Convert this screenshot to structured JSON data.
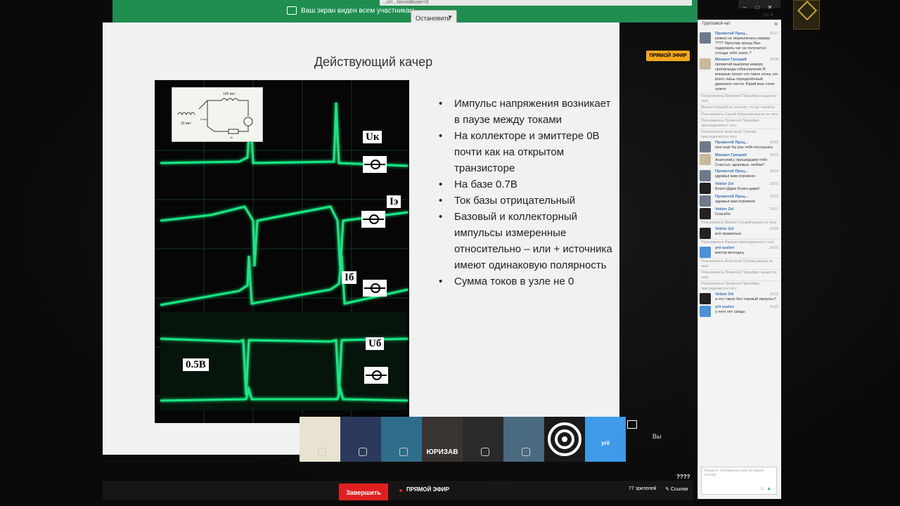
{
  "topbar": {
    "share_notice": "Ваш экран виден всем участникам",
    "stop_label": "Остановить",
    "url_fragment": "...ci=...forcedifuser=0"
  },
  "slide": {
    "title": "Действующий качер",
    "bullets": [
      "Импульс напряжения возникает в паузе между токами",
      "На коллекторе и эмиттере 0В почти  как на открытом транзисторе",
      "На базе 0.7В",
      "Ток базы отрицательный",
      "Базовый и коллекторный импульсы измеренные относительно – или + источника имеют одинаковую полярность",
      "Сумма токов в узле не 0"
    ],
    "scope_labels": {
      "uk": "Uк",
      "ie": "Iэ",
      "ib": "Iб",
      "ub": "Uб",
      "scale": "0.5В"
    },
    "circuit": {
      "l1": "30 вит",
      "l2": "100 вит",
      "l3": "5 вит",
      "r": "1k"
    }
  },
  "live_badge": "ПРЯМОЙ ЭФИР",
  "participants": [
    {
      "id": "p1",
      "name": "",
      "color": "#e8e3d0"
    },
    {
      "id": "p2",
      "name": "",
      "color": "#2b3a5a"
    },
    {
      "id": "p3",
      "name": "",
      "color": "#2f6d8a"
    },
    {
      "id": "p4",
      "name": "ЮРИЗАВ",
      "color": "#3a3430"
    },
    {
      "id": "p5",
      "name": "",
      "color": "#2a2a2a"
    },
    {
      "id": "p6",
      "name": "",
      "color": "#4a6a80"
    },
    {
      "id": "p7",
      "name": "",
      "color": "#1a1a1a"
    },
    {
      "id": "p8",
      "name": "yrii",
      "color": "#3d9be9"
    }
  ],
  "you_label": "Вы",
  "bottombar": {
    "finish_label": "Завершить",
    "live_label": "ПРЯМОЙ ЭФИР",
    "viewers": "77 зрителей",
    "links": "Ссылки",
    "qmarks": "????"
  },
  "chat": {
    "header": "Групповой чат",
    "input_placeholder": "Введите сообщение или вставьте ссылку",
    "messages": [
      {
        "type": "msg",
        "author": "Прометей Прец...",
        "time": "18:1?",
        "text": "можно не переключать камеру ???? Ярослав прошу Вас подержать чат не получится отсюда тебе знать ?",
        "avatar": "#6d7a8a"
      },
      {
        "type": "msg",
        "author": "Михаил Грецкий",
        "time": "18:38",
        "text": "прометей выключи камеру пропаганда глбансерения Я впервые понял что такое огонь это всего лишь определённый диапазон частот Юрий мне стоит нужно",
        "avatar": "#c8b89a"
      },
      {
        "type": "sys",
        "text": "Пользователь Прометей Прецейвис вышел из чата"
      },
      {
        "type": "sys",
        "text": "Михаил Грецкий не успешит, что вы говорите"
      },
      {
        "type": "sys",
        "text": "Пользователь Сергей Шершнев вышел из чата"
      },
      {
        "type": "sys",
        "text": "Пользователь Прометей Прецейвис присоединился к чату"
      },
      {
        "type": "sys",
        "text": "Пользователь Анастасия Гулиева присоединился к чату"
      },
      {
        "type": "msg",
        "author": "Прометей Прец...",
        "time": "18:53",
        "text": "мэн ещё бы раз тебя послушать",
        "avatar": "#6d7a8a"
      },
      {
        "type": "msg",
        "author": "Михаил Грецкий",
        "time": "18:53",
        "text": "Анатолий,с прошедшим тебя Счастья, здоровья, любви!!",
        "avatar": "#c8b89a"
      },
      {
        "type": "msg",
        "author": "Прометей Прец...",
        "time": "18:54",
        "text": "здравья вам огромное",
        "avatar": "#6d7a8a"
      },
      {
        "type": "msg",
        "author": "Vektor Zel",
        "time": "18:55",
        "text": "Благо-Дарю Благо-дарю!",
        "avatar": "#222"
      },
      {
        "type": "msg",
        "author": "Прометей Прец...",
        "time": "18:03",
        "text": "здравья вам огромное",
        "avatar": "#6d7a8a"
      },
      {
        "type": "msg",
        "author": "Vektor Zel",
        "time": "19:07",
        "text": "Спасибо",
        "avatar": "#222"
      },
      {
        "type": "sys",
        "text": "Пользователь Михаил Грецкий вышел из чата"
      },
      {
        "type": "msg",
        "author": "Vektor Zel",
        "time": "19:09",
        "text": "всё правильно",
        "avatar": "#222"
      },
      {
        "type": "sys",
        "text": "Пользователь Юрская присоединился к чату"
      },
      {
        "type": "msg",
        "author": "yrii suslov",
        "time": "19:05",
        "text": "вектор молодец",
        "avatar": "#4a90d9"
      },
      {
        "type": "sys",
        "text": "Пользователь Анастасия Гулиева вышел из чата"
      },
      {
        "type": "sys",
        "text": "Пользователь Прометей Прецейвис вышел из чата"
      },
      {
        "type": "sys",
        "text": "Пользователь Прометей Прецейвис присоединился к чату"
      },
      {
        "type": "msg",
        "author": "Vektor Zel",
        "time": "19:11",
        "text": "а что такое без токовый импульс?",
        "avatar": "#222"
      },
      {
        "type": "msg",
        "author": "yrii suslov",
        "time": "19:20",
        "text": "у него нет среды",
        "avatar": "#4a90d9"
      }
    ]
  },
  "colors": {
    "accent": "#1f8e4f",
    "finish": "#e02020",
    "badge": "#f4a71c",
    "trace": "#19e884"
  },
  "icons": [
    "screen-share-icon",
    "close-icon",
    "mute-icon",
    "link-icon",
    "smile-icon"
  ]
}
